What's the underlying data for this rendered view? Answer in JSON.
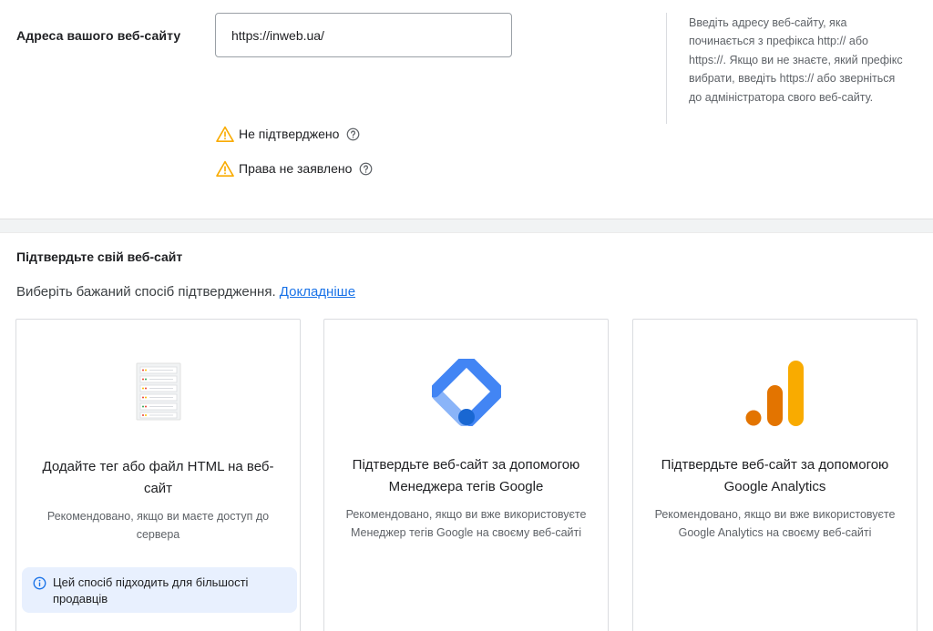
{
  "website": {
    "label": "Адреса вашого веб-сайту",
    "url_value": "https://inweb.ua/",
    "help_text": "Введіть адресу веб-сайту, яка починається з префікса http:// або https://. Якщо ви не знаєте, який префікс вибрати, введіть https:// або зверніться до адміністратора свого веб-сайту."
  },
  "statuses": [
    {
      "text": "Не підтверджено",
      "icon": "warning-icon",
      "help_icon": "help-circle-icon"
    },
    {
      "text": "Права не заявлено",
      "icon": "warning-icon",
      "help_icon": "help-circle-icon"
    }
  ],
  "verify": {
    "title": "Підтвердьте свій веб-сайт",
    "subtitle": "Виберіть бажаний спосіб підтвердження.",
    "learn_more": "Докладніше"
  },
  "cards": [
    {
      "icon": "server-html-icon",
      "title": "Додайте тег або файл HTML на веб-сайт",
      "description": "Рекомендовано, якщо ви маєте доступ до сервера",
      "note": "Цей спосіб підходить для більшості продавців",
      "note_icon": "info-icon"
    },
    {
      "icon": "google-tag-manager-icon",
      "title": "Підтвердьте веб-сайт за допомогою Менеджера тегів Google",
      "description": "Рекомендовано, якщо ви вже використовуєте Менеджер тегів Google на своєму веб-сайті"
    },
    {
      "icon": "google-analytics-icon",
      "title": "Підтвердьте веб-сайт за допомогою Google Analytics",
      "description": "Рекомендовано, якщо ви вже використовуєте Google Analytics на своєму веб-сайті"
    }
  ],
  "colors": {
    "link": "#1a73e8",
    "warning": "#f9ab00",
    "note_background": "#e8f0fe",
    "gtm_blue": "#4285f4",
    "analytics_orange": "#f9ab00",
    "analytics_dark_orange": "#e37400"
  }
}
